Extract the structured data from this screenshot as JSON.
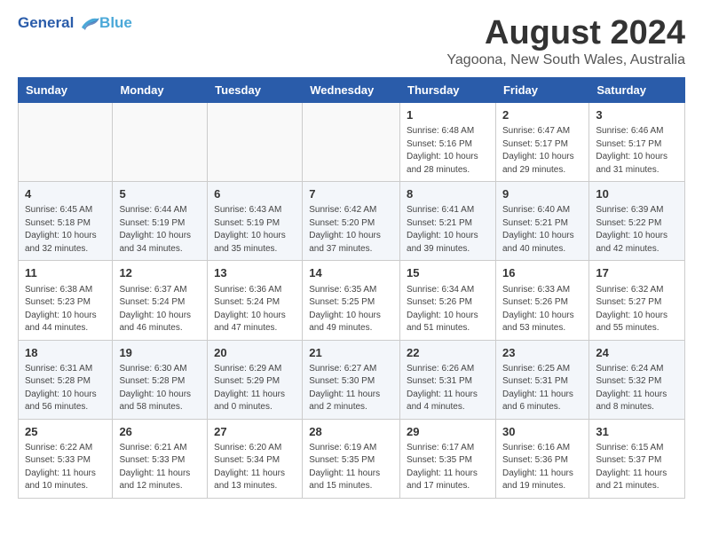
{
  "header": {
    "logo_line1": "General",
    "logo_line2": "Blue",
    "title": "August 2024",
    "subtitle": "Yagoona, New South Wales, Australia"
  },
  "days_of_week": [
    "Sunday",
    "Monday",
    "Tuesday",
    "Wednesday",
    "Thursday",
    "Friday",
    "Saturday"
  ],
  "weeks": [
    [
      {
        "day": "",
        "info": ""
      },
      {
        "day": "",
        "info": ""
      },
      {
        "day": "",
        "info": ""
      },
      {
        "day": "",
        "info": ""
      },
      {
        "day": "1",
        "info": "Sunrise: 6:48 AM\nSunset: 5:16 PM\nDaylight: 10 hours\nand 28 minutes."
      },
      {
        "day": "2",
        "info": "Sunrise: 6:47 AM\nSunset: 5:17 PM\nDaylight: 10 hours\nand 29 minutes."
      },
      {
        "day": "3",
        "info": "Sunrise: 6:46 AM\nSunset: 5:17 PM\nDaylight: 10 hours\nand 31 minutes."
      }
    ],
    [
      {
        "day": "4",
        "info": "Sunrise: 6:45 AM\nSunset: 5:18 PM\nDaylight: 10 hours\nand 32 minutes."
      },
      {
        "day": "5",
        "info": "Sunrise: 6:44 AM\nSunset: 5:19 PM\nDaylight: 10 hours\nand 34 minutes."
      },
      {
        "day": "6",
        "info": "Sunrise: 6:43 AM\nSunset: 5:19 PM\nDaylight: 10 hours\nand 35 minutes."
      },
      {
        "day": "7",
        "info": "Sunrise: 6:42 AM\nSunset: 5:20 PM\nDaylight: 10 hours\nand 37 minutes."
      },
      {
        "day": "8",
        "info": "Sunrise: 6:41 AM\nSunset: 5:21 PM\nDaylight: 10 hours\nand 39 minutes."
      },
      {
        "day": "9",
        "info": "Sunrise: 6:40 AM\nSunset: 5:21 PM\nDaylight: 10 hours\nand 40 minutes."
      },
      {
        "day": "10",
        "info": "Sunrise: 6:39 AM\nSunset: 5:22 PM\nDaylight: 10 hours\nand 42 minutes."
      }
    ],
    [
      {
        "day": "11",
        "info": "Sunrise: 6:38 AM\nSunset: 5:23 PM\nDaylight: 10 hours\nand 44 minutes."
      },
      {
        "day": "12",
        "info": "Sunrise: 6:37 AM\nSunset: 5:24 PM\nDaylight: 10 hours\nand 46 minutes."
      },
      {
        "day": "13",
        "info": "Sunrise: 6:36 AM\nSunset: 5:24 PM\nDaylight: 10 hours\nand 47 minutes."
      },
      {
        "day": "14",
        "info": "Sunrise: 6:35 AM\nSunset: 5:25 PM\nDaylight: 10 hours\nand 49 minutes."
      },
      {
        "day": "15",
        "info": "Sunrise: 6:34 AM\nSunset: 5:26 PM\nDaylight: 10 hours\nand 51 minutes."
      },
      {
        "day": "16",
        "info": "Sunrise: 6:33 AM\nSunset: 5:26 PM\nDaylight: 10 hours\nand 53 minutes."
      },
      {
        "day": "17",
        "info": "Sunrise: 6:32 AM\nSunset: 5:27 PM\nDaylight: 10 hours\nand 55 minutes."
      }
    ],
    [
      {
        "day": "18",
        "info": "Sunrise: 6:31 AM\nSunset: 5:28 PM\nDaylight: 10 hours\nand 56 minutes."
      },
      {
        "day": "19",
        "info": "Sunrise: 6:30 AM\nSunset: 5:28 PM\nDaylight: 10 hours\nand 58 minutes."
      },
      {
        "day": "20",
        "info": "Sunrise: 6:29 AM\nSunset: 5:29 PM\nDaylight: 11 hours\nand 0 minutes."
      },
      {
        "day": "21",
        "info": "Sunrise: 6:27 AM\nSunset: 5:30 PM\nDaylight: 11 hours\nand 2 minutes."
      },
      {
        "day": "22",
        "info": "Sunrise: 6:26 AM\nSunset: 5:31 PM\nDaylight: 11 hours\nand 4 minutes."
      },
      {
        "day": "23",
        "info": "Sunrise: 6:25 AM\nSunset: 5:31 PM\nDaylight: 11 hours\nand 6 minutes."
      },
      {
        "day": "24",
        "info": "Sunrise: 6:24 AM\nSunset: 5:32 PM\nDaylight: 11 hours\nand 8 minutes."
      }
    ],
    [
      {
        "day": "25",
        "info": "Sunrise: 6:22 AM\nSunset: 5:33 PM\nDaylight: 11 hours\nand 10 minutes."
      },
      {
        "day": "26",
        "info": "Sunrise: 6:21 AM\nSunset: 5:33 PM\nDaylight: 11 hours\nand 12 minutes."
      },
      {
        "day": "27",
        "info": "Sunrise: 6:20 AM\nSunset: 5:34 PM\nDaylight: 11 hours\nand 13 minutes."
      },
      {
        "day": "28",
        "info": "Sunrise: 6:19 AM\nSunset: 5:35 PM\nDaylight: 11 hours\nand 15 minutes."
      },
      {
        "day": "29",
        "info": "Sunrise: 6:17 AM\nSunset: 5:35 PM\nDaylight: 11 hours\nand 17 minutes."
      },
      {
        "day": "30",
        "info": "Sunrise: 6:16 AM\nSunset: 5:36 PM\nDaylight: 11 hours\nand 19 minutes."
      },
      {
        "day": "31",
        "info": "Sunrise: 6:15 AM\nSunset: 5:37 PM\nDaylight: 11 hours\nand 21 minutes."
      }
    ]
  ]
}
